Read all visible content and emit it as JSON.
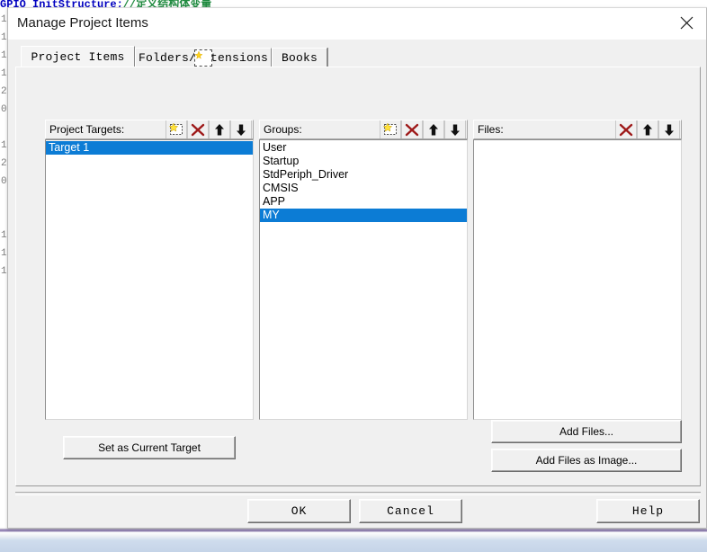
{
  "background": {
    "code_line_prefix": "    GPIO_InitStructure;",
    "code_line_comment": "//定义结构体变量",
    "gutter_marks": [
      "1",
      "1",
      "1",
      "1",
      "2",
      "0",
      "",
      "1",
      "2",
      "0",
      "",
      "",
      "1",
      "1",
      "1",
      "",
      "",
      "",
      "",
      "",
      "",
      "",
      "",
      "",
      "",
      ""
    ]
  },
  "dialog": {
    "title": "Manage Project Items",
    "close_icon": "close-icon"
  },
  "tabs": [
    {
      "label": "Project Items",
      "selected": true
    },
    {
      "label": "Folders/Extensions",
      "selected": false
    },
    {
      "label": "Books",
      "selected": false
    }
  ],
  "panes": {
    "targets": {
      "label": "Project Targets:",
      "tools": [
        {
          "name": "new-item-icon",
          "title": "New (Insert)"
        },
        {
          "name": "delete-item-icon",
          "title": "Delete (Del)"
        },
        {
          "name": "move-up-icon",
          "title": "Move Up"
        },
        {
          "name": "move-down-icon",
          "title": "Move Down"
        }
      ],
      "items": [
        {
          "label": "Target 1",
          "selected": true
        }
      ]
    },
    "groups": {
      "label": "Groups:",
      "tools": [
        {
          "name": "new-item-icon",
          "title": "New (Insert)"
        },
        {
          "name": "delete-item-icon",
          "title": "Delete (Del)"
        },
        {
          "name": "move-up-icon",
          "title": "Move Up"
        },
        {
          "name": "move-down-icon",
          "title": "Move Down"
        }
      ],
      "items": [
        {
          "label": "User",
          "selected": false
        },
        {
          "label": "Startup",
          "selected": false
        },
        {
          "label": "StdPeriph_Driver",
          "selected": false
        },
        {
          "label": "CMSIS",
          "selected": false
        },
        {
          "label": "APP",
          "selected": false
        },
        {
          "label": "MY",
          "selected": true
        }
      ]
    },
    "files": {
      "label": "Files:",
      "tools": [
        {
          "name": "delete-item-icon",
          "title": "Delete (Del)"
        },
        {
          "name": "move-up-icon",
          "title": "Move Up"
        },
        {
          "name": "move-down-icon",
          "title": "Move Down"
        }
      ],
      "items": []
    }
  },
  "actions": {
    "set_as_current_target": "Set as Current Target",
    "add_files": "Add Files...",
    "add_files_as_image": "Add Files as Image..."
  },
  "footer": {
    "ok": "OK",
    "cancel": "Cancel",
    "help": "Help"
  },
  "colors": {
    "selection_blue": "#0c7cd5",
    "dialog_face": "#f0f0f0",
    "delete_red": "#9e1a1a",
    "new_star_yellow": "#ffe23a",
    "accent_purple": "#8f7fb0"
  }
}
